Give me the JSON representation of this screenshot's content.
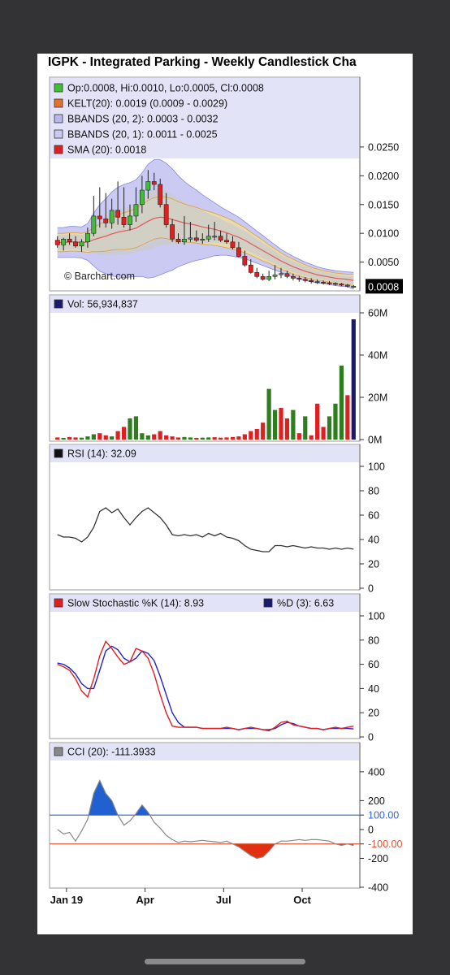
{
  "title": "IGPK - Integrated Parking - Weekly Candlestick Cha",
  "colors": {
    "up": "#3fbf35",
    "down": "#e02020",
    "vol_up": "#2e7d1f",
    "vol_down": "#e02020",
    "pane_bg": "#ffffff",
    "legend_bg": "#e3e3f7",
    "bb2": "#b8b8ee",
    "bb1": "#cbcbcb",
    "kelt": "#f0dd9a",
    "sma": "#e06060",
    "stoch_k": "#e02020",
    "stoch_d": "#2222cc",
    "cci_fill": "#2060d0",
    "cci_neg": "#e03010",
    "line_100": "#3366cc",
    "line_m100": "#e05030"
  },
  "watermark": "© Barchart.com",
  "chart_data": [
    {
      "type": "candlestick",
      "pane": "price",
      "legend": [
        {
          "swatch": "#3fbf35",
          "text": "Op:0.0008, Hi:0.0010, Lo:0.0005, Cl:0.0008"
        },
        {
          "swatch": "#e8702a",
          "text": "KELT(20): 0.0019 (0.0009 - 0.0029)"
        },
        {
          "swatch": "#b8b8ee",
          "text": "BBANDS (20, 2): 0.0003 - 0.0032"
        },
        {
          "swatch": "#c8c8f0",
          "text": "BBANDS (20, 1): 0.0011 - 0.0025"
        },
        {
          "swatch": "#e02020",
          "text": "SMA (20): 0.0018"
        }
      ],
      "ylim": [
        0,
        0.024
      ],
      "yticks": [
        "0.0250",
        "0.0200",
        "0.0150",
        "0.0100",
        "0.0050"
      ],
      "ytick_values": [
        0.025,
        0.02,
        0.015,
        0.01,
        0.005
      ],
      "last_value": "0.0008",
      "x_index": [
        0,
        1,
        2,
        3,
        4,
        5,
        6,
        7,
        8,
        9,
        10,
        11,
        12,
        13,
        14,
        15,
        16,
        17,
        18,
        19,
        20,
        21,
        22,
        23,
        24,
        25,
        26,
        27,
        28,
        29,
        30,
        31,
        32,
        33,
        34,
        35,
        36,
        37,
        38,
        39,
        40,
        41,
        42,
        43,
        44,
        45,
        46,
        47,
        48,
        49
      ],
      "open": [
        0.0088,
        0.008,
        0.009,
        0.0085,
        0.0078,
        0.0085,
        0.01,
        0.013,
        0.0125,
        0.0118,
        0.014,
        0.0128,
        0.0115,
        0.013,
        0.015,
        0.0175,
        0.019,
        0.0185,
        0.015,
        0.0115,
        0.009,
        0.0085,
        0.009,
        0.0092,
        0.0088,
        0.009,
        0.0095,
        0.0095,
        0.0088,
        0.0085,
        0.0075,
        0.006,
        0.0045,
        0.0032,
        0.0025,
        0.002,
        0.0025,
        0.0028,
        0.003,
        0.0025,
        0.0022,
        0.002,
        0.0018,
        0.0016,
        0.0015,
        0.0014,
        0.0013,
        0.0012,
        0.001,
        0.0008
      ],
      "high": [
        0.0095,
        0.0092,
        0.01,
        0.0095,
        0.009,
        0.011,
        0.0165,
        0.018,
        0.017,
        0.016,
        0.019,
        0.018,
        0.015,
        0.018,
        0.02,
        0.021,
        0.0205,
        0.0195,
        0.017,
        0.0125,
        0.01,
        0.013,
        0.012,
        0.0105,
        0.01,
        0.0115,
        0.012,
        0.0105,
        0.01,
        0.0095,
        0.0085,
        0.007,
        0.0055,
        0.004,
        0.003,
        0.0035,
        0.0045,
        0.004,
        0.0035,
        0.003,
        0.0026,
        0.0024,
        0.0022,
        0.002,
        0.0018,
        0.0017,
        0.0015,
        0.0014,
        0.0012,
        0.001
      ],
      "low": [
        0.0075,
        0.007,
        0.008,
        0.0075,
        0.0068,
        0.0075,
        0.0095,
        0.011,
        0.011,
        0.0108,
        0.0115,
        0.011,
        0.0105,
        0.012,
        0.0135,
        0.016,
        0.0175,
        0.0145,
        0.011,
        0.0085,
        0.0082,
        0.008,
        0.0085,
        0.0085,
        0.0082,
        0.0085,
        0.0088,
        0.0085,
        0.0082,
        0.0072,
        0.0058,
        0.0042,
        0.003,
        0.0022,
        0.0018,
        0.0017,
        0.002,
        0.0022,
        0.0022,
        0.0018,
        0.0016,
        0.0015,
        0.0013,
        0.0012,
        0.0011,
        0.001,
        0.0009,
        0.0008,
        0.0006,
        0.0005
      ],
      "close": [
        0.008,
        0.009,
        0.0085,
        0.0078,
        0.0085,
        0.01,
        0.013,
        0.0125,
        0.0118,
        0.014,
        0.0128,
        0.0115,
        0.013,
        0.015,
        0.0175,
        0.019,
        0.0185,
        0.015,
        0.0115,
        0.009,
        0.0085,
        0.009,
        0.0092,
        0.0088,
        0.009,
        0.0095,
        0.0095,
        0.0088,
        0.0085,
        0.0075,
        0.006,
        0.0045,
        0.0032,
        0.0025,
        0.002,
        0.0025,
        0.0028,
        0.003,
        0.0025,
        0.0022,
        0.002,
        0.0018,
        0.0016,
        0.0015,
        0.0014,
        0.0013,
        0.0012,
        0.001,
        0.0008,
        0.0008
      ],
      "kelt_mid": [
        0.0084,
        0.0084,
        0.0085,
        0.0085,
        0.0084,
        0.0085,
        0.0089,
        0.0092,
        0.0095,
        0.0099,
        0.0102,
        0.0104,
        0.0106,
        0.0109,
        0.0115,
        0.0121,
        0.0126,
        0.0128,
        0.0127,
        0.0124,
        0.0121,
        0.0118,
        0.0116,
        0.0114,
        0.0111,
        0.0109,
        0.0107,
        0.0104,
        0.0101,
        0.0097,
        0.0093,
        0.0088,
        0.0082,
        0.0076,
        0.007,
        0.0064,
        0.0058,
        0.0052,
        0.0047,
        0.0042,
        0.0038,
        0.0034,
        0.0031,
        0.0028,
        0.0026,
        0.0024,
        0.0022,
        0.0021,
        0.002,
        0.0019
      ],
      "kelt_upper": [
        0.01,
        0.01,
        0.0101,
        0.0101,
        0.01,
        0.0103,
        0.011,
        0.0116,
        0.0121,
        0.0127,
        0.0132,
        0.0136,
        0.0139,
        0.0143,
        0.015,
        0.0157,
        0.0162,
        0.0164,
        0.0163,
        0.016,
        0.0155,
        0.0151,
        0.0148,
        0.0145,
        0.0141,
        0.0138,
        0.0135,
        0.0131,
        0.0127,
        0.0122,
        0.0116,
        0.011,
        0.0102,
        0.0095,
        0.0088,
        0.008,
        0.0073,
        0.0066,
        0.006,
        0.0055,
        0.005,
        0.0045,
        0.0041,
        0.0038,
        0.0035,
        0.0033,
        0.0031,
        0.003,
        0.0029,
        0.0029
      ],
      "kelt_lower": [
        0.0068,
        0.0068,
        0.0069,
        0.0069,
        0.0068,
        0.0067,
        0.0068,
        0.0068,
        0.0069,
        0.0071,
        0.0072,
        0.0072,
        0.0073,
        0.0075,
        0.008,
        0.0085,
        0.009,
        0.0092,
        0.0091,
        0.0088,
        0.0087,
        0.0085,
        0.0084,
        0.0083,
        0.0081,
        0.008,
        0.0079,
        0.0077,
        0.0075,
        0.0072,
        0.007,
        0.0066,
        0.0062,
        0.0057,
        0.0052,
        0.0048,
        0.0043,
        0.0038,
        0.0034,
        0.0029,
        0.0026,
        0.0023,
        0.0021,
        0.0018,
        0.0017,
        0.0015,
        0.0013,
        0.0012,
        0.0011,
        0.0009
      ],
      "bb2_upper": [
        0.011,
        0.011,
        0.0112,
        0.0112,
        0.0111,
        0.0117,
        0.0135,
        0.015,
        0.016,
        0.0172,
        0.018,
        0.0185,
        0.0188,
        0.0193,
        0.0205,
        0.022,
        0.0228,
        0.0228,
        0.0222,
        0.0212,
        0.02,
        0.019,
        0.0182,
        0.0175,
        0.0167,
        0.016,
        0.0153,
        0.0146,
        0.014,
        0.0134,
        0.0128,
        0.012,
        0.0112,
        0.0104,
        0.0096,
        0.0088,
        0.008,
        0.0072,
        0.0066,
        0.006,
        0.0055,
        0.005,
        0.0046,
        0.0042,
        0.0039,
        0.0037,
        0.0035,
        0.0034,
        0.0033,
        0.0032
      ],
      "bb2_lower": [
        0.0058,
        0.0058,
        0.0058,
        0.0058,
        0.0057,
        0.0053,
        0.0043,
        0.0034,
        0.003,
        0.0026,
        0.0024,
        0.0023,
        0.0024,
        0.0025,
        0.0025,
        0.0022,
        0.0024,
        0.0028,
        0.0032,
        0.0036,
        0.0042,
        0.0046,
        0.005,
        0.0053,
        0.0055,
        0.0058,
        0.0061,
        0.0062,
        0.0062,
        0.006,
        0.0058,
        0.0056,
        0.0052,
        0.0048,
        0.0044,
        0.004,
        0.0036,
        0.0032,
        0.0028,
        0.0024,
        0.0021,
        0.0018,
        0.0016,
        0.0014,
        0.0013,
        0.0011,
        0.0009,
        0.0008,
        0.0007,
        0.0003
      ],
      "bb1_upper": [
        0.0097,
        0.0097,
        0.0098,
        0.0098,
        0.0097,
        0.0101,
        0.0112,
        0.0121,
        0.0128,
        0.0136,
        0.0141,
        0.0144,
        0.0147,
        0.0151,
        0.016,
        0.0171,
        0.0177,
        0.0178,
        0.0174,
        0.0168,
        0.0161,
        0.0154,
        0.0149,
        0.0144,
        0.0139,
        0.0134,
        0.013,
        0.0125,
        0.012,
        0.0115,
        0.011,
        0.0104,
        0.0097,
        0.009,
        0.0083,
        0.0076,
        0.0069,
        0.0062,
        0.0057,
        0.0051,
        0.0047,
        0.0042,
        0.0039,
        0.0035,
        0.0033,
        0.0031,
        0.0029,
        0.0027,
        0.0026,
        0.0025
      ],
      "bb1_lower": [
        0.0071,
        0.0071,
        0.0072,
        0.0072,
        0.0071,
        0.0069,
        0.0066,
        0.0063,
        0.0062,
        0.0062,
        0.0063,
        0.0064,
        0.0065,
        0.0067,
        0.007,
        0.0071,
        0.0075,
        0.0078,
        0.008,
        0.008,
        0.0081,
        0.0082,
        0.0083,
        0.0084,
        0.0083,
        0.0084,
        0.0084,
        0.0083,
        0.0082,
        0.0079,
        0.0076,
        0.0072,
        0.0067,
        0.0062,
        0.0057,
        0.0052,
        0.0047,
        0.0042,
        0.0037,
        0.0033,
        0.0029,
        0.0026,
        0.0023,
        0.0021,
        0.0019,
        0.0017,
        0.0015,
        0.0015,
        0.0013,
        0.0011
      ],
      "sma": [
        0.0084,
        0.0084,
        0.0085,
        0.0085,
        0.0084,
        0.0085,
        0.0089,
        0.0092,
        0.0095,
        0.0099,
        0.0102,
        0.0104,
        0.0106,
        0.0109,
        0.0115,
        0.0121,
        0.0126,
        0.0128,
        0.0127,
        0.0124,
        0.0121,
        0.0118,
        0.0116,
        0.0114,
        0.0111,
        0.0109,
        0.0107,
        0.0104,
        0.0101,
        0.0097,
        0.0093,
        0.0088,
        0.0082,
        0.0076,
        0.007,
        0.0064,
        0.0058,
        0.0052,
        0.0047,
        0.0042,
        0.0038,
        0.0034,
        0.0031,
        0.0028,
        0.0026,
        0.0024,
        0.0022,
        0.0021,
        0.002,
        0.0018
      ]
    },
    {
      "type": "bar",
      "pane": "volume",
      "legend": [
        {
          "swatch": "#1a1a6e",
          "text": "Vol: 56,934,837"
        }
      ],
      "ylim": [
        0,
        60000000
      ],
      "yticks": [
        "60M",
        "40M",
        "20M",
        "0M"
      ],
      "ytick_values": [
        60000000,
        40000000,
        20000000,
        0
      ],
      "values": [
        1000000,
        800000,
        1200000,
        1000000,
        900000,
        1500000,
        2500000,
        3000000,
        2000000,
        1500000,
        4000000,
        6000000,
        10000000,
        11000000,
        3000000,
        2000000,
        2500000,
        4000000,
        2000000,
        1500000,
        1000000,
        1200000,
        1000000,
        800000,
        900000,
        1000000,
        1100000,
        900000,
        1000000,
        1200000,
        1500000,
        2500000,
        4000000,
        5000000,
        8000000,
        24000000,
        14000000,
        15000000,
        10000000,
        14000000,
        3000000,
        11000000,
        2000000,
        17000000,
        6000000,
        11000000,
        17000000,
        35000000,
        21000000,
        56934837
      ],
      "up": [
        false,
        true,
        false,
        false,
        true,
        true,
        true,
        false,
        false,
        true,
        false,
        false,
        true,
        true,
        true,
        true,
        false,
        false,
        false,
        false,
        false,
        true,
        true,
        false,
        true,
        true,
        false,
        false,
        false,
        false,
        false,
        false,
        false,
        false,
        false,
        true,
        true,
        false,
        false,
        true,
        false,
        true,
        false,
        false,
        false,
        true,
        true,
        true,
        false,
        true
      ],
      "last_color": "#1a1a6e"
    },
    {
      "type": "line",
      "pane": "rsi",
      "legend": [
        {
          "swatch": "#111111",
          "text": "RSI (14): 32.09"
        }
      ],
      "ylim": [
        0,
        100
      ],
      "yticks": [
        "100",
        "80",
        "60",
        "40",
        "20",
        "0"
      ],
      "ytick_values": [
        100,
        80,
        60,
        40,
        20,
        0
      ],
      "series": [
        {
          "name": "RSI (14)",
          "color": "#333333",
          "values": [
            44,
            42,
            42,
            41,
            38,
            42,
            50,
            63,
            66,
            62,
            65,
            58,
            52,
            58,
            63,
            66,
            62,
            58,
            52,
            44,
            43,
            44,
            43,
            44,
            42,
            45,
            43,
            45,
            42,
            41,
            39,
            35,
            32,
            31,
            30,
            30,
            35,
            35,
            34,
            35,
            34,
            33,
            34,
            33,
            33,
            32,
            33,
            32,
            33,
            32.09
          ]
        }
      ]
    },
    {
      "type": "line",
      "pane": "stochastic",
      "legend": [
        {
          "swatch": "#e02020",
          "text": "Slow Stochastic %K (14): 8.93"
        },
        {
          "swatch": "#1a1a6e",
          "text": "%D (3): 6.63"
        }
      ],
      "ylim": [
        0,
        100
      ],
      "yticks": [
        "100",
        "80",
        "60",
        "40",
        "20",
        "0"
      ],
      "ytick_values": [
        100,
        80,
        60,
        40,
        20,
        0
      ],
      "series": [
        {
          "name": "Slow Stochastic %K (14)",
          "color": "#e02020",
          "values": [
            60,
            58,
            55,
            48,
            38,
            33,
            48,
            67,
            79,
            73,
            66,
            60,
            62,
            73,
            71,
            65,
            52,
            35,
            20,
            9,
            8,
            8,
            8,
            8,
            7,
            7,
            7,
            7,
            8,
            7,
            6,
            7,
            8,
            7,
            6,
            5,
            8,
            12,
            13,
            10,
            9,
            8,
            7,
            7,
            6,
            7,
            8,
            7,
            8,
            8.93
          ]
        },
        {
          "name": "%D (3)",
          "color": "#2222cc",
          "values": [
            61,
            60,
            57,
            52,
            44,
            40,
            40,
            55,
            71,
            75,
            72,
            65,
            62,
            65,
            71,
            69,
            63,
            50,
            35,
            20,
            12,
            8,
            8,
            8,
            7,
            7,
            7,
            7,
            7,
            7,
            6,
            7,
            7,
            7,
            6,
            6,
            7,
            10,
            12,
            11,
            9,
            8,
            7,
            7,
            6,
            7,
            7,
            7,
            7,
            6.63
          ]
        }
      ]
    },
    {
      "type": "area",
      "pane": "cci",
      "legend": [
        {
          "swatch": "#888888",
          "text": "CCI (20): -111.3933"
        }
      ],
      "ylim": [
        -400,
        450
      ],
      "yticks": [
        "400",
        "200",
        "100.00",
        "0",
        "-100.00",
        "-200",
        "-400"
      ],
      "ytick_values": [
        400,
        200,
        100,
        0,
        -100,
        -200,
        -400
      ],
      "ref_lines": [
        100,
        -100
      ],
      "series": [
        {
          "name": "CCI (20)",
          "color": "#888888",
          "values": [
            0,
            -30,
            -20,
            -80,
            -10,
            70,
            250,
            340,
            250,
            200,
            100,
            30,
            60,
            110,
            170,
            120,
            50,
            10,
            -40,
            -70,
            -90,
            -80,
            -85,
            -80,
            -75,
            -80,
            -85,
            -90,
            -80,
            -100,
            -120,
            -150,
            -180,
            -200,
            -190,
            -150,
            -100,
            -80,
            -80,
            -75,
            -70,
            -75,
            -70,
            -70,
            -75,
            -80,
            -100,
            -110,
            -100,
            -111.3933
          ]
        }
      ]
    }
  ],
  "x_axis": {
    "labels": [
      {
        "text": "Jan 19",
        "index": 1.5
      },
      {
        "text": "Apr",
        "index": 14.5
      },
      {
        "text": "Jul",
        "index": 27.5
      },
      {
        "text": "Oct",
        "index": 40.5
      }
    ]
  }
}
